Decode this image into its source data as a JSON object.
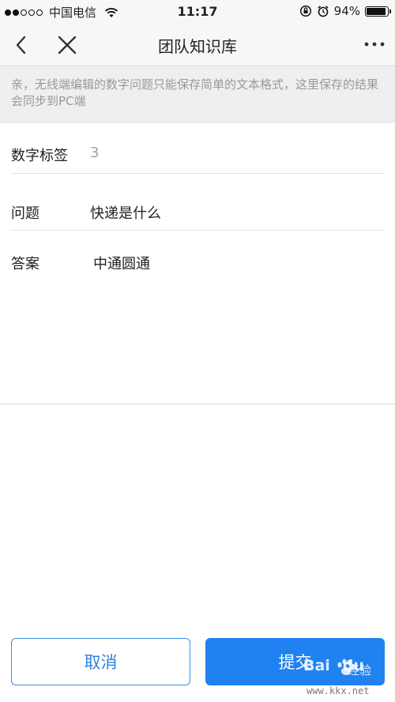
{
  "status_bar": {
    "carrier": "中国电信",
    "time": "11:17",
    "battery_text": "94%",
    "battery_level": 0.94
  },
  "nav": {
    "title": "团队知识库"
  },
  "notice": {
    "text": "亲，无线端编辑的数字问题只能保存简单的文本格式，这里保存的结果会同步到PC端"
  },
  "form": {
    "number_tag": {
      "label": "数字标签",
      "value": "3"
    },
    "question": {
      "label": "问题",
      "value": "快递是什么"
    },
    "answer": {
      "label": "答案",
      "value": "中通圆通"
    }
  },
  "buttons": {
    "cancel": "取消",
    "submit": "提交"
  },
  "watermark": {
    "brand": "Bai",
    "brand_suffix": "du",
    "jingyan": "经验",
    "site": "www.kkx.net"
  },
  "colors": {
    "accent": "#1f82f0",
    "notice_bg": "#efeff2",
    "placeholder_text": "#a0a0a0"
  }
}
